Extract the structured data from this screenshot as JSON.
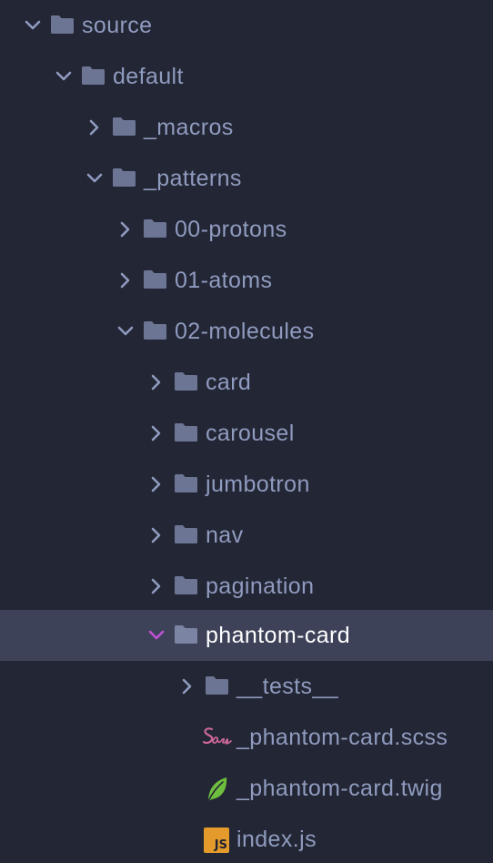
{
  "tree": [
    {
      "label": "source",
      "type": "folder",
      "expanded": true,
      "depth": 0
    },
    {
      "label": "default",
      "type": "folder",
      "expanded": true,
      "depth": 1
    },
    {
      "label": "_macros",
      "type": "folder",
      "expanded": false,
      "depth": 2
    },
    {
      "label": "_patterns",
      "type": "folder",
      "expanded": true,
      "depth": 2
    },
    {
      "label": "00-protons",
      "type": "folder",
      "expanded": false,
      "depth": 3
    },
    {
      "label": "01-atoms",
      "type": "folder",
      "expanded": false,
      "depth": 3
    },
    {
      "label": "02-molecules",
      "type": "folder",
      "expanded": true,
      "depth": 3
    },
    {
      "label": "card",
      "type": "folder",
      "expanded": false,
      "depth": 4
    },
    {
      "label": "carousel",
      "type": "folder",
      "expanded": false,
      "depth": 4
    },
    {
      "label": "jumbotron",
      "type": "folder",
      "expanded": false,
      "depth": 4
    },
    {
      "label": "nav",
      "type": "folder",
      "expanded": false,
      "depth": 4
    },
    {
      "label": "pagination",
      "type": "folder",
      "expanded": false,
      "depth": 4
    },
    {
      "label": "phantom-card",
      "type": "folder",
      "expanded": true,
      "selected": true,
      "depth": 4
    },
    {
      "label": "__tests__",
      "type": "folder",
      "expanded": false,
      "depth": 5
    },
    {
      "label": "_phantom-card.scss",
      "type": "file",
      "icon": "sass-icon",
      "depth": 5
    },
    {
      "label": "_phantom-card.twig",
      "type": "file",
      "icon": "twig-leaf-icon",
      "depth": 5
    },
    {
      "label": "index.js",
      "type": "file",
      "icon": "js-icon",
      "icon_text": "JS",
      "depth": 5
    }
  ],
  "colors": {
    "background": "#232634",
    "selected_row": "#3d4259",
    "text": "#8f9bbf",
    "selected_text": "#ffffff",
    "folder_icon": "#6c7594",
    "chevron": "#8f9bbf",
    "selected_chevron": "#c451d6",
    "sass": "#cd6799",
    "twig_leaf": "#6fbf3f",
    "js_badge": "#e49b2c"
  }
}
